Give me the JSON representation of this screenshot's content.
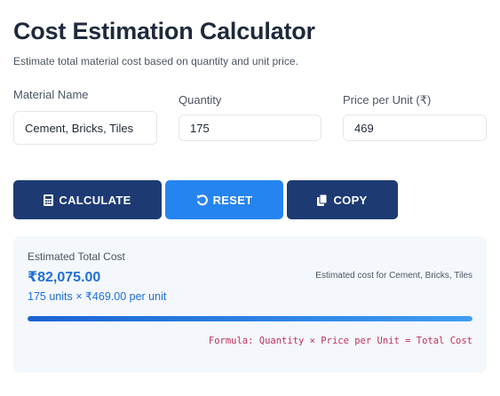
{
  "header": {
    "title": "Cost Estimation Calculator",
    "subtitle": "Estimate total material cost based on quantity and unit price."
  },
  "form": {
    "material": {
      "label": "Material Name",
      "value": "Cement, Bricks, Tiles"
    },
    "quantity": {
      "label": "Quantity",
      "value": "175"
    },
    "price": {
      "label": "Price per Unit (₹)",
      "value": "469"
    }
  },
  "buttons": {
    "calculate": {
      "label": "CALCULATE",
      "icon": "calculator-icon"
    },
    "reset": {
      "label": "RESET",
      "icon": "reset-icon"
    },
    "copy": {
      "label": "COPY",
      "icon": "copy-icon"
    }
  },
  "result": {
    "label": "Estimated Total Cost",
    "total": "₹82,075.00",
    "detail": "175 units × ₹469.00 per unit",
    "note": "Estimated cost for Cement, Bricks, Tiles",
    "progress": 1.0,
    "formula": "Formula: Quantity × Price per Unit = Total Cost"
  },
  "colors": {
    "primary_dark": "#1d3a73",
    "primary_blue": "#2684f0",
    "accent_text": "#1f6fd6",
    "formula_text": "#c0305a",
    "card_bg": "#f4f7fc"
  }
}
